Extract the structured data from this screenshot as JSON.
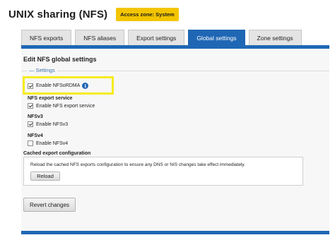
{
  "header": {
    "title": "UNIX sharing (NFS)",
    "zone_badge": "Access zone: System"
  },
  "tabs": [
    {
      "label": "NFS exports",
      "active": false
    },
    {
      "label": "NFS aliases",
      "active": false
    },
    {
      "label": "Export settings",
      "active": false
    },
    {
      "label": "Global settings",
      "active": true
    },
    {
      "label": "Zone settings",
      "active": false
    }
  ],
  "panel": {
    "title": "Edit NFS global settings",
    "settings_legend": "Settings",
    "rdma": {
      "label": "Enable NFSoRDMA",
      "checked": true
    },
    "export_service": {
      "group": "NFS export service",
      "label": "Enable NFS export service",
      "checked": true
    },
    "nfsv3": {
      "group": "NFSv3",
      "label": "Enable NFSv3",
      "checked": true
    },
    "nfsv4": {
      "group": "NFSv4",
      "label": "Enable NFSv4",
      "checked": false
    },
    "cache": {
      "group": "Cached export configuration",
      "text": "Reload the cached NFS exports configuration to ensure any DNS or NIS changes take effect immediately.",
      "reload_label": "Reload"
    },
    "revert_label": "Revert changes"
  },
  "colors": {
    "accent": "#1f67b5",
    "badge": "#f3c500",
    "highlight": "#f6ec1a"
  },
  "icons": {
    "info": "info-icon"
  }
}
